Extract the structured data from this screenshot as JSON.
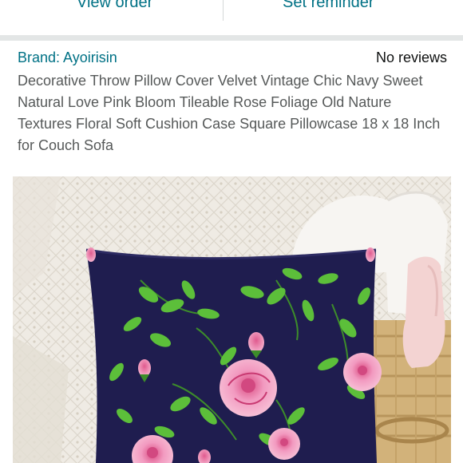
{
  "actions": {
    "view_order": "View order",
    "set_reminder": "Set reminder"
  },
  "product": {
    "brand": "Brand: Ayoirisin",
    "reviews": "No reviews",
    "title": "Decorative Throw Pillow Cover Velvet Vintage Chic Navy Sweet Natural Love Pink Bloom Tileable Rose Foliage Old Nature Textures Floral Soft Cushion Case Square Pillowcase 18 x 18 Inch for Couch Sofa"
  },
  "colors": {
    "link": "#007185",
    "pillow_navy": "#1f1d4f",
    "rose_pink": "#f4a3c4",
    "leaf_green": "#5cbf3a",
    "separator": "#e3e6e6"
  }
}
